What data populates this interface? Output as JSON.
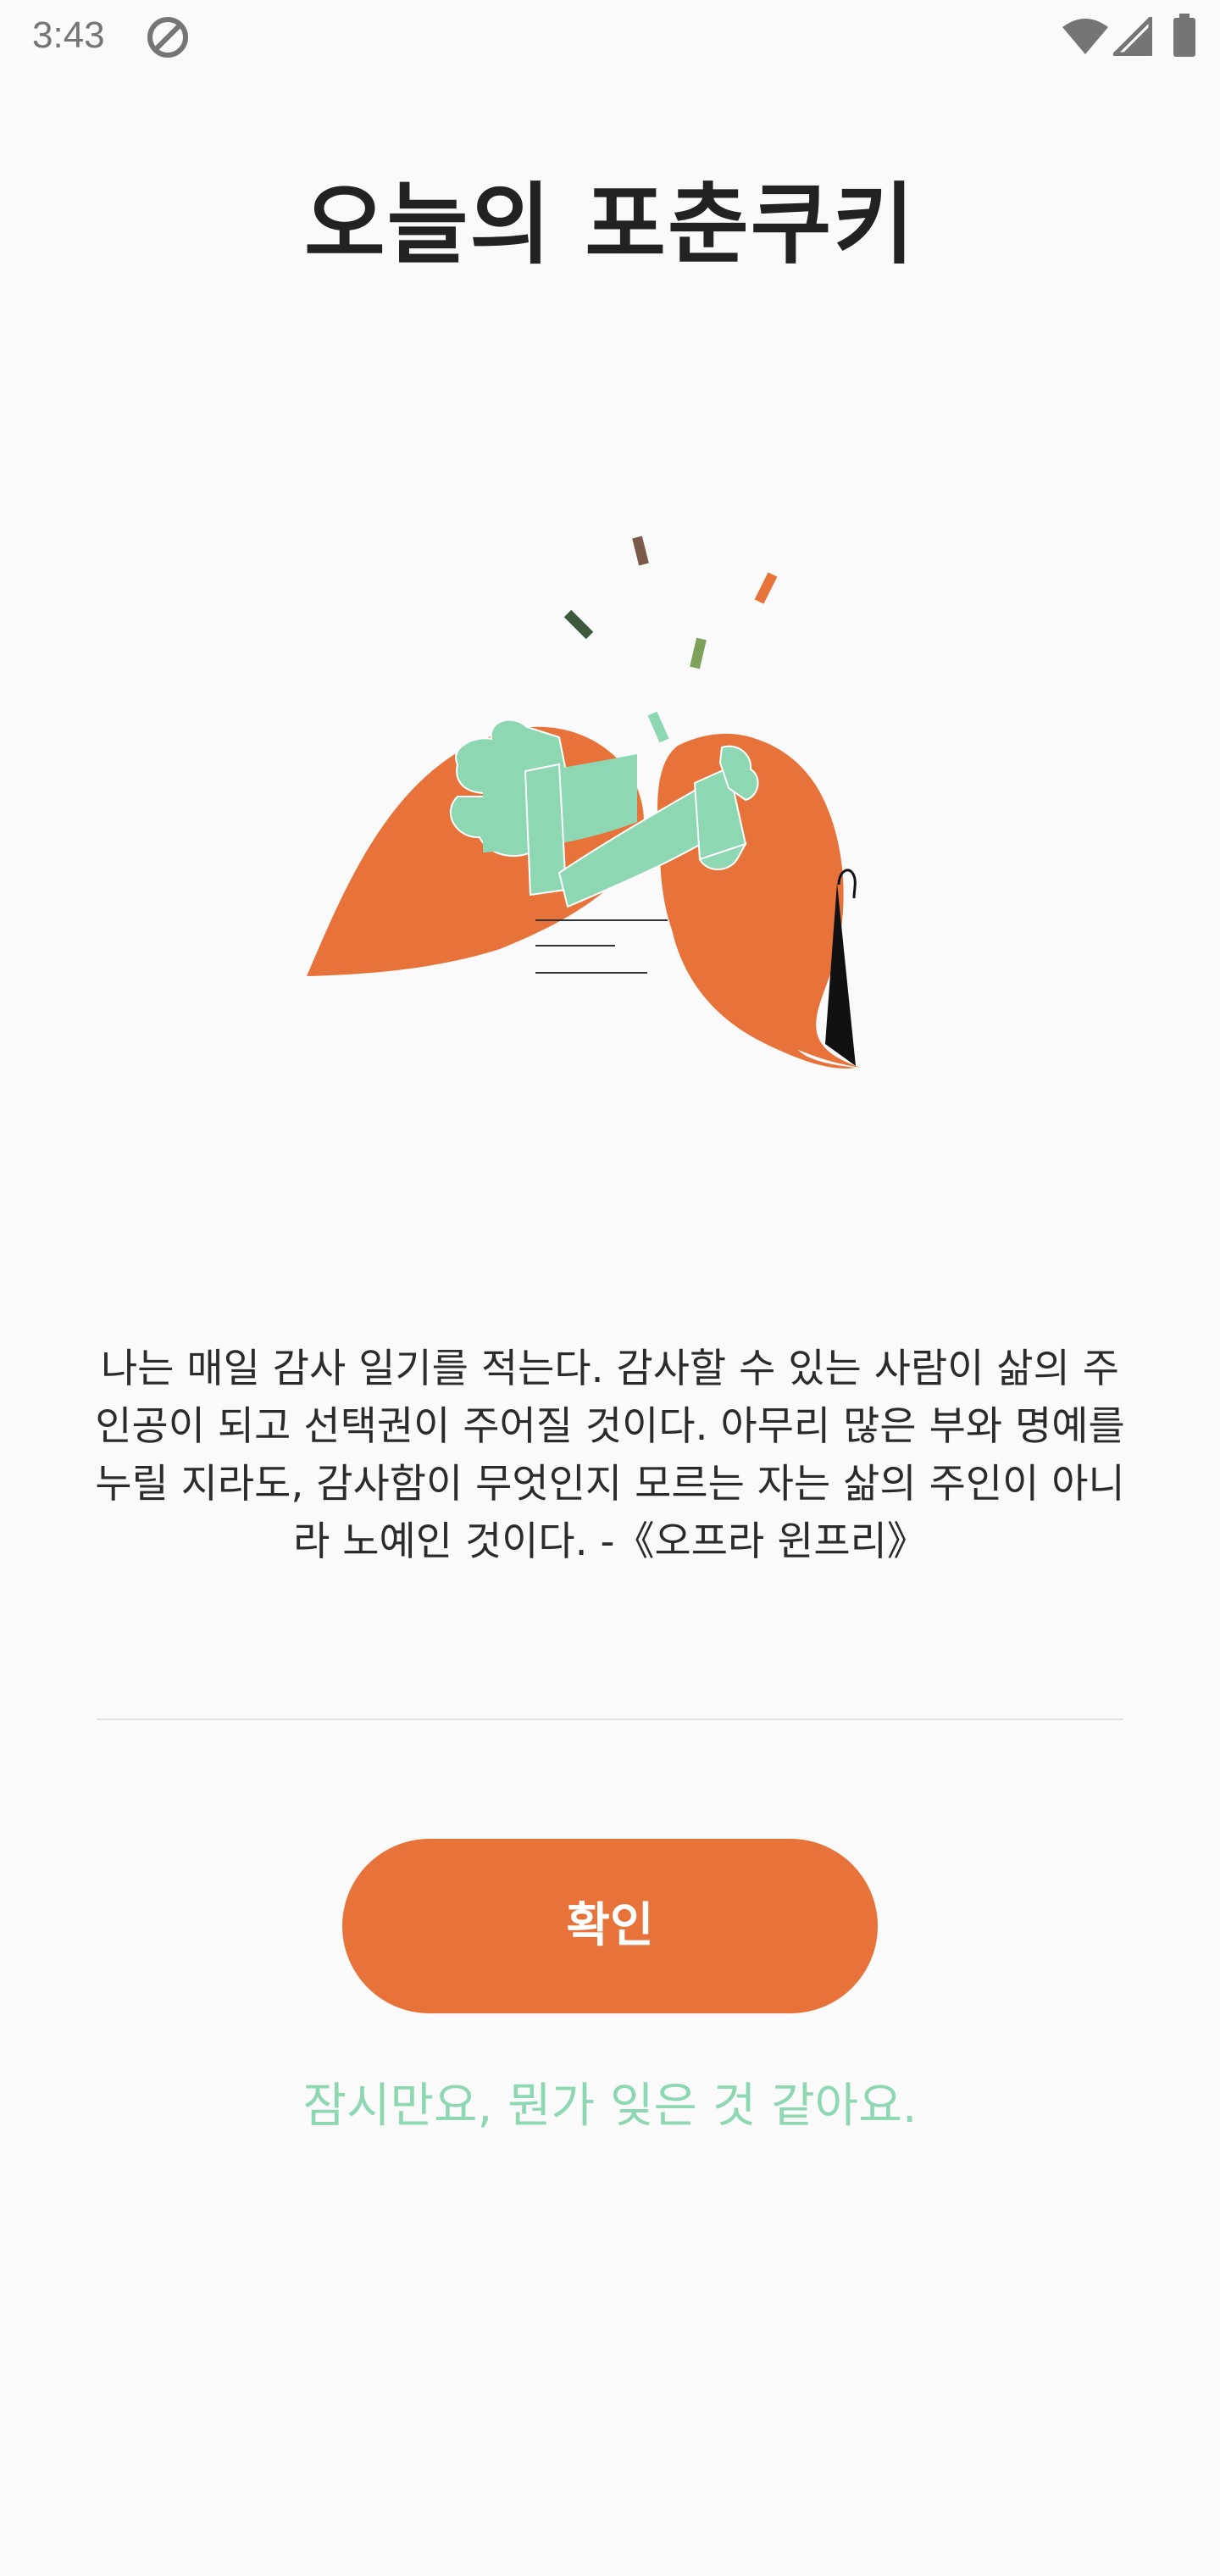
{
  "status_bar": {
    "time": "3:43",
    "icons": [
      "do-not-disturb-icon",
      "wifi-icon",
      "signal-icon",
      "battery-icon"
    ]
  },
  "page": {
    "title": "오늘의 포춘쿠키",
    "quote": "나는 매일 감사 일기를 적는다. 감사할 수 있는 사람이 삶의 주\n인공이 되고 선택권이 주어질 것이다. 아무리 많은 부와 명예를\n누릴 지라도, 감사함이 무엇인지 모르는 자는 삶의 주인이 아니\n라 노예인 것이다. -《오프라 윈프리》"
  },
  "actions": {
    "confirm_label": "확인",
    "secondary_label": "잠시만요, 뭔가 잊은 것 같아요."
  },
  "illustration": {
    "name": "fortune-cookie-illustration",
    "colors": {
      "cookie": "#e8733a",
      "paper": "#8ed7b3",
      "confetti_brown": "#7a5a48",
      "confetti_dark_green": "#3e5a3e",
      "confetti_olive": "#7da05a",
      "confetti_mint": "#8ed7b3",
      "confetti_orange": "#e8733a"
    }
  },
  "theme": {
    "accent": "#e8733a",
    "link": "#8ed7b3",
    "background": "#fafafa",
    "text": "#222222"
  }
}
